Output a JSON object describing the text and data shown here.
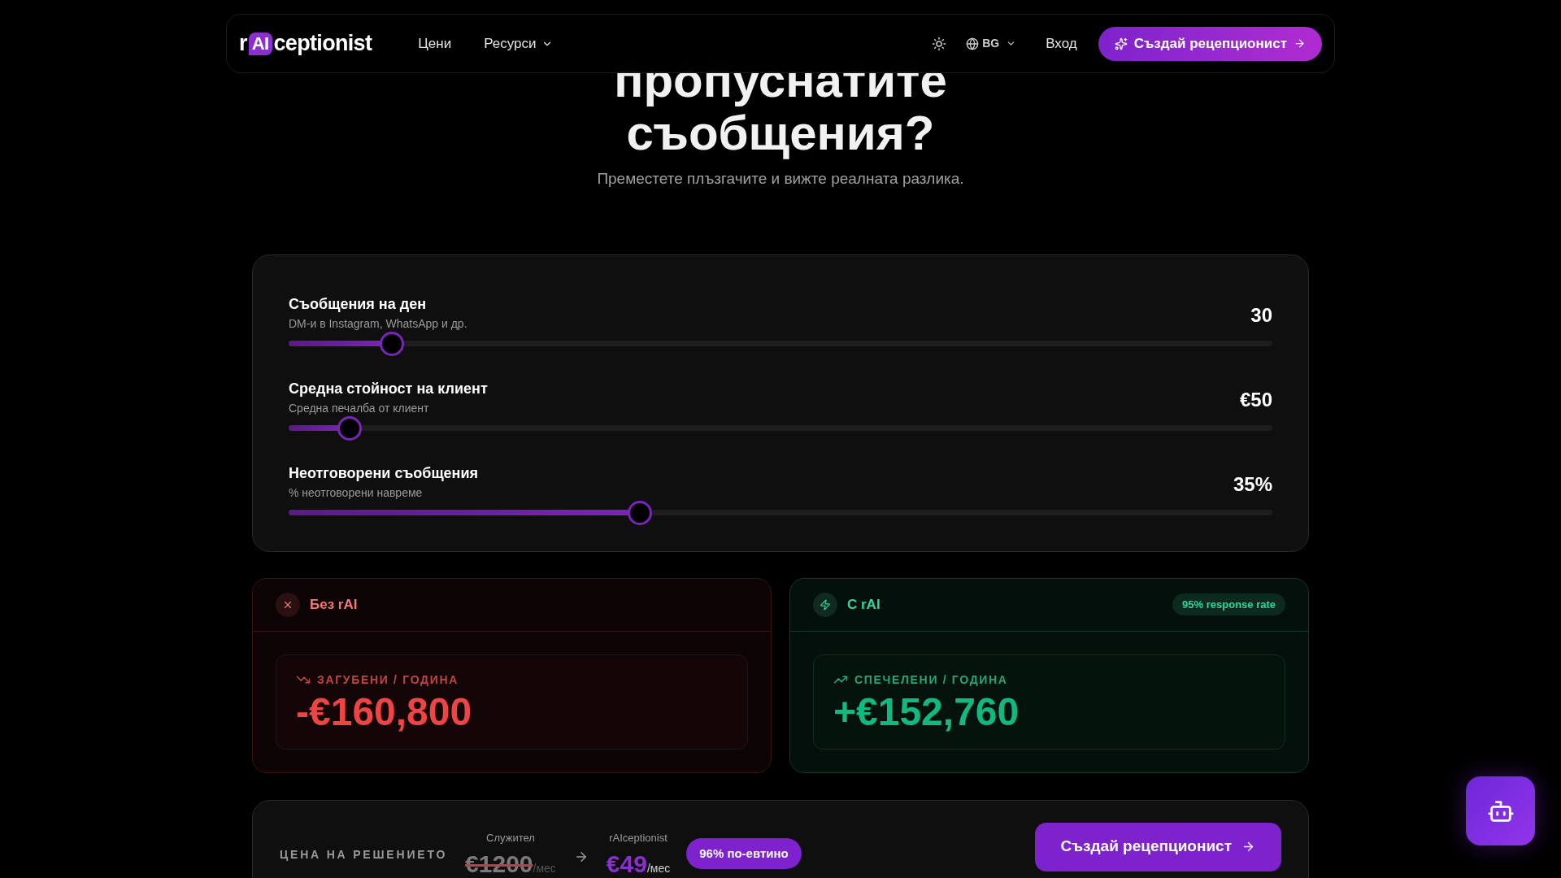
{
  "nav": {
    "logo_prefix": "r",
    "logo_badge": "AI",
    "logo_suffix": "ceptionist",
    "links": [
      {
        "label": "Цени",
        "dropdown": false
      },
      {
        "label": "Ресурси",
        "dropdown": true
      }
    ],
    "language": "BG",
    "login": "Вход",
    "cta": "Създай рецепционист"
  },
  "hero": {
    "title_lines": [
      "пропуснатите",
      "съобщения?"
    ],
    "subtitle": "Преместете плъзгачите и вижте реалната разлика."
  },
  "sliders": [
    {
      "label": "Съобщения на ден",
      "hint": "DM-и в Instagram, WhatsApp и др.",
      "reading": "30",
      "level": 0.105
    },
    {
      "label": "Средна стойност на клиент",
      "hint": "Средна печалба от клиент",
      "reading": "€50",
      "level": 0.062
    },
    {
      "label": "Неотговорени съобщения",
      "hint": "% неотговорени навреме",
      "reading": "35%",
      "level": 0.357
    }
  ],
  "results": [
    {
      "kind": "loss",
      "title": "Без rAI",
      "metric_label": "ЗАГУБЕНИ / ГОДИНА",
      "amount": "-€160,800"
    },
    {
      "kind": "gain",
      "title": "С rAI",
      "badge": "95% response rate",
      "metric_label": "СПЕЧЕЛЕНИ / ГОДИНА",
      "amount": "+€152,760"
    }
  ],
  "pricing": {
    "label": "ЦЕНА НА РЕШЕНИЕТО",
    "old": {
      "caption": "Служител",
      "price": "€1200",
      "unit": "/мес"
    },
    "new": {
      "caption": "rAIceptionist",
      "price": "€49",
      "unit": "/мес"
    },
    "badge": "96% по-евтино",
    "cta": "Създай рецепционист"
  }
}
